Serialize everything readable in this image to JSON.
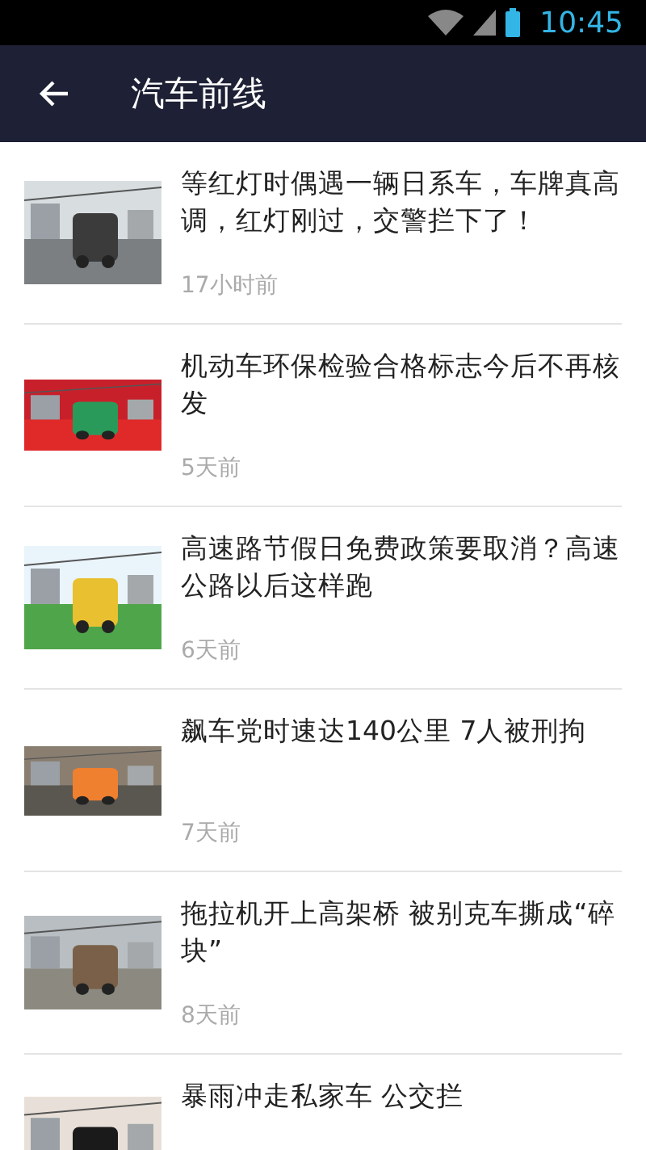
{
  "status_bar": {
    "time": "10:45"
  },
  "app_bar": {
    "title": "汽车前线"
  },
  "articles": [
    {
      "title": "等红灯时偶遇一辆日系车，车牌真高调，红灯刚过，交警拦下了！",
      "time": "17小时前"
    },
    {
      "title": "机动车环保检验合格标志今后不再核发",
      "time": "5天前"
    },
    {
      "title": "高速路节假日免费政策要取消？高速公路以后这样跑",
      "time": "6天前"
    },
    {
      "title": "飙车党时速达140公里 7人被刑拘",
      "time": "7天前"
    },
    {
      "title": "拖拉机开上高架桥 被别克车撕成“碎块”",
      "time": "8天前"
    },
    {
      "title": "暴雨冲走私家车 公交拦"
    }
  ]
}
